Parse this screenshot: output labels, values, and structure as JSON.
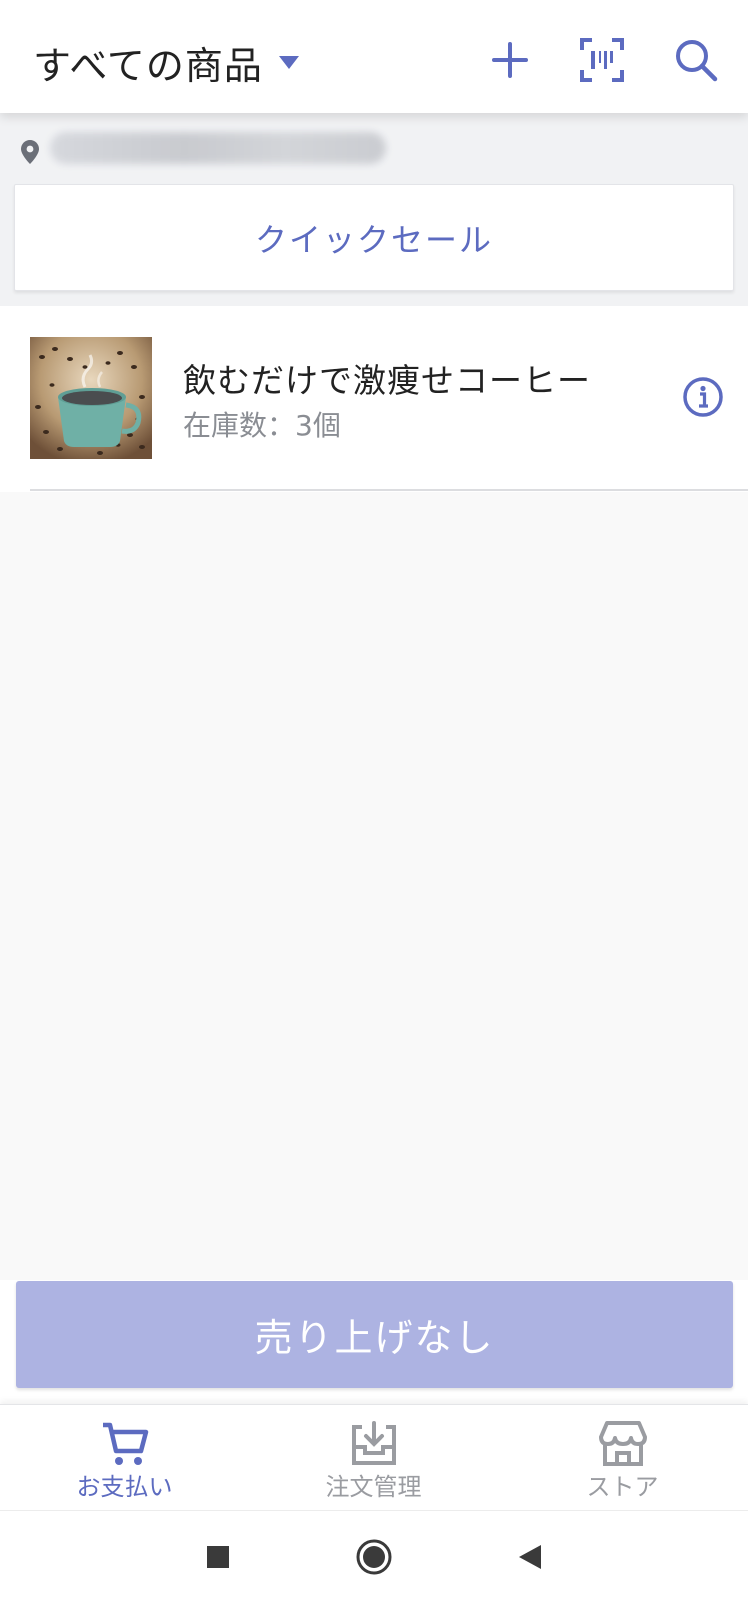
{
  "header": {
    "title": "すべての商品",
    "icons": {
      "add": "plus-icon",
      "barcode": "barcode-scan-icon",
      "search": "search-icon",
      "dropdown": "caret-down-icon"
    }
  },
  "location": {
    "icon": "location-pin-icon",
    "text": ""
  },
  "quick_sale": {
    "label": "クイックセール"
  },
  "products": [
    {
      "name": "飲むだけで激痩せコーヒー",
      "stock": "在庫数：3個",
      "image": "coffee-cup-thumbnail",
      "info_icon": "info-icon"
    }
  ],
  "sales_button": {
    "label": "売り上げなし"
  },
  "tabs": [
    {
      "label": "お支払い",
      "icon": "cart-icon",
      "active": true
    },
    {
      "label": "注文管理",
      "icon": "inbox-download-icon",
      "active": false
    },
    {
      "label": "ストア",
      "icon": "store-icon",
      "active": false
    }
  ],
  "system_nav": {
    "icons": [
      "square-recents-icon",
      "circle-home-icon",
      "triangle-back-icon"
    ]
  },
  "colors": {
    "accent": "#5c6bc0",
    "sales_button": "#adb3e2",
    "muted": "#9a9ca1"
  }
}
